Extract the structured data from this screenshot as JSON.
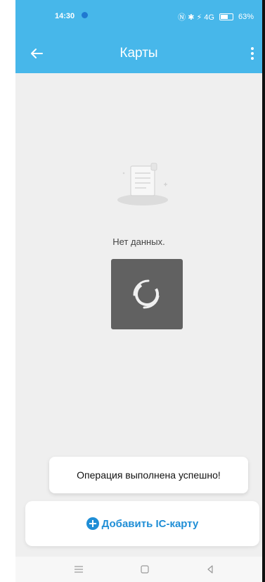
{
  "status_bar": {
    "time": "14:30",
    "icons_text": "Ⓝ ✱ ⚡ 4G",
    "battery": "63%"
  },
  "header": {
    "title": "Карты",
    "back_icon": "arrow-left-icon",
    "menu_icon": "more-vert-icon"
  },
  "empty_state": {
    "message": "Нет данных.",
    "illustration_icon": "document-illustration-icon"
  },
  "loading": {
    "icon": "spinner-icon"
  },
  "toast": {
    "message": "Операция выполнена успешно!"
  },
  "actions": {
    "add_card_label": "Добавить IC-карту",
    "add_card_icon": "plus-circle-icon"
  },
  "nav_bar": {
    "buttons": [
      "menu-lines-icon",
      "square-icon",
      "triangle-back-icon"
    ]
  },
  "colors": {
    "header": "#47b7ea",
    "accent": "#1f8ed6",
    "background": "#efefef",
    "loading_tile": "#616161"
  }
}
